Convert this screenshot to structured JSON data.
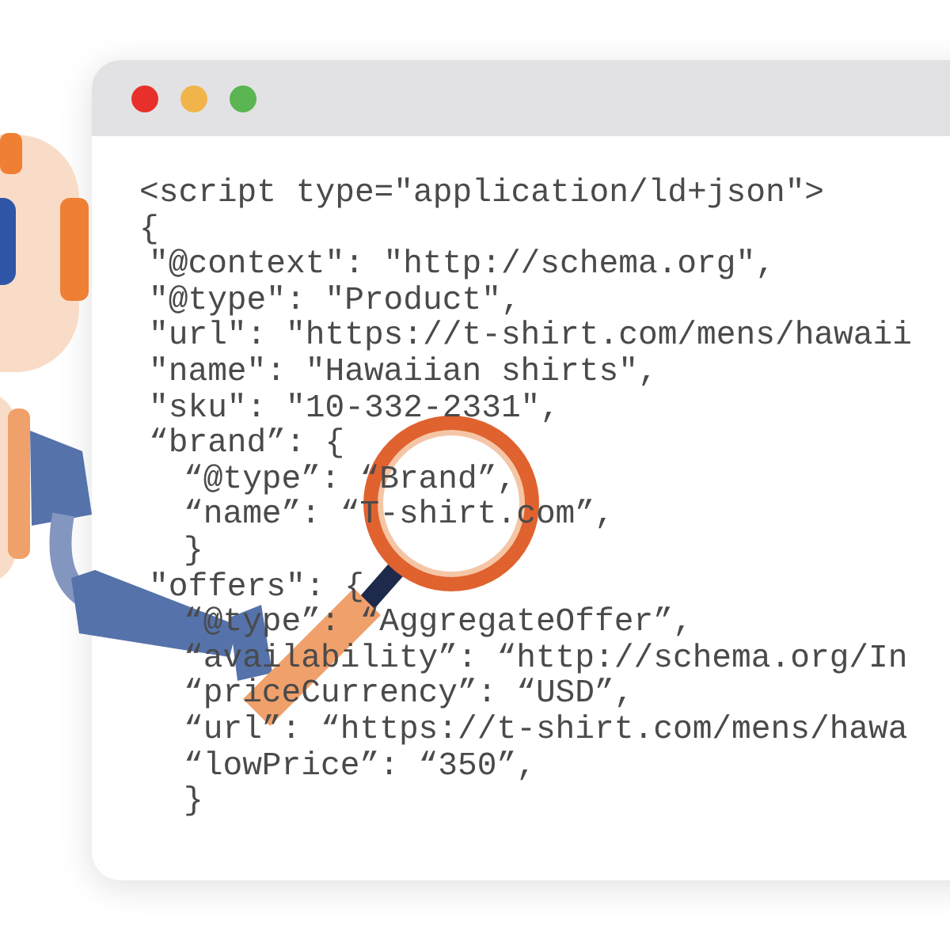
{
  "code": [
    {
      "text": "<script type=\"application/ld+json\">"
    },
    {
      "text": "{",
      "children": [
        {
          "text": "\"@context\": \"http://schema.org\","
        },
        {
          "text": "\"@type\": \"Product\","
        },
        {
          "text": "\"url\": \"https://t-shirt.com/mens/hawaii"
        },
        {
          "text": "\"name\": \"Hawaiian shirts\","
        },
        {
          "text": "\"sku\": \"10-332-2331\","
        },
        {
          "text": "“brand”: {",
          "children": [
            {
              "text": "“@type”: “Brand”,"
            },
            {
              "text": "“name”: “T-shirt.com”,"
            },
            {
              "text": "}"
            }
          ]
        },
        {
          "text": "\"offers\": {",
          "children": [
            {
              "text": "“@type”: “AggregateOffer”,"
            },
            {
              "text": "“availability”: “http://schema.org/In"
            },
            {
              "text": "“priceCurrency”: “USD”,"
            },
            {
              "text": "“url”: “https://t-shirt.com/mens/hawa"
            },
            {
              "text": "“lowPrice”: “350”,"
            },
            {
              "text": "}"
            }
          ]
        }
      ]
    }
  ]
}
